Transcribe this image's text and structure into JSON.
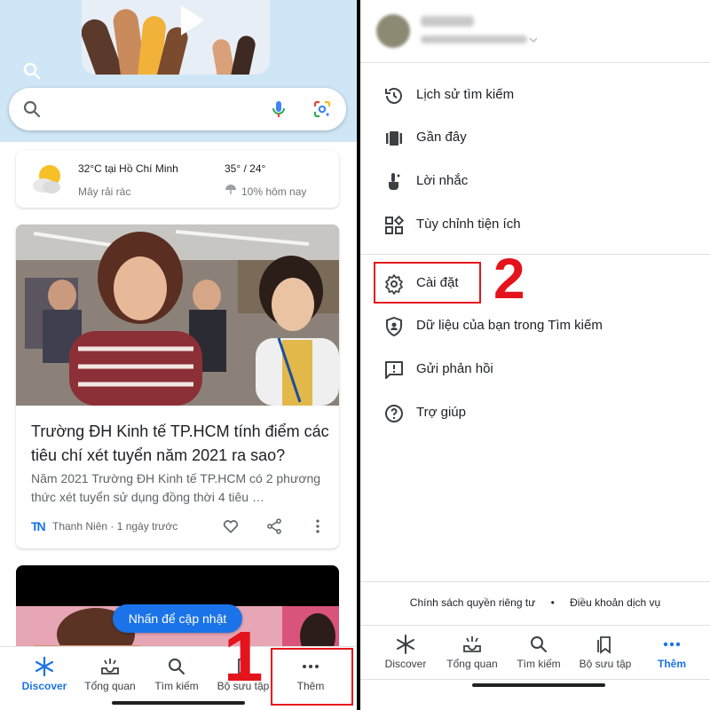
{
  "left": {
    "weather": {
      "location_temp": "32°C tại Hồ Chí Minh",
      "condition": "Mây rải rác",
      "high_low": "35° / 24°",
      "rain": "10% hôm nay"
    },
    "article": {
      "title": "Trường ĐH Kinh tế TP.HCM tính điểm các tiêu chí xét tuyển năm 2021 ra sao?",
      "description": "Năm 2021 Trường ĐH Kinh tế TP.HCM có 2 phương thức xét tuyển sử dụng đồng thời 4 tiêu …",
      "source": "Thanh Niên · 1 ngày trước",
      "source_logo": "TN"
    },
    "update_button": "Nhấn để cập nhật",
    "nav": [
      {
        "label": "Discover",
        "icon": "asterisk-icon",
        "color": "#1a73e8"
      },
      {
        "label": "Tổng quan",
        "icon": "inbox-sparkle-icon"
      },
      {
        "label": "Tìm kiếm",
        "icon": "search-icon"
      },
      {
        "label": "Bộ sưu tập",
        "icon": "bookmarks-icon"
      },
      {
        "label": "Thêm",
        "icon": "more-icon"
      }
    ],
    "annotation_number": "1"
  },
  "right": {
    "menu": [
      {
        "label": "Lịch sử tìm kiếm",
        "icon": "history-icon"
      },
      {
        "label": "Gần đây",
        "icon": "recent-icon"
      },
      {
        "label": "Lời nhắc",
        "icon": "reminder-icon"
      },
      {
        "label": "Tùy chỉnh tiện ích",
        "icon": "widgets-icon"
      },
      {
        "label": "Cài đặt",
        "icon": "gear-icon"
      },
      {
        "label": "Dữ liệu của bạn trong Tìm kiếm",
        "icon": "shield-account-icon"
      },
      {
        "label": "Gửi phản hồi",
        "icon": "feedback-icon"
      },
      {
        "label": "Trợ giúp",
        "icon": "help-icon"
      }
    ],
    "footer": {
      "privacy": "Chính sách quyền riêng tư",
      "separator": "•",
      "terms": "Điều khoản dịch vụ"
    },
    "nav": [
      {
        "label": "Discover",
        "icon": "asterisk-icon"
      },
      {
        "label": "Tổng quan",
        "icon": "inbox-sparkle-icon"
      },
      {
        "label": "Tìm kiếm",
        "icon": "search-icon"
      },
      {
        "label": "Bộ sưu tập",
        "icon": "bookmarks-icon"
      },
      {
        "label": "Thêm",
        "icon": "more-icon",
        "color": "#1a73e8"
      }
    ],
    "annotation_number": "2"
  },
  "colors": {
    "accent": "#1a73e8",
    "annotation_red": "#e5131c"
  }
}
